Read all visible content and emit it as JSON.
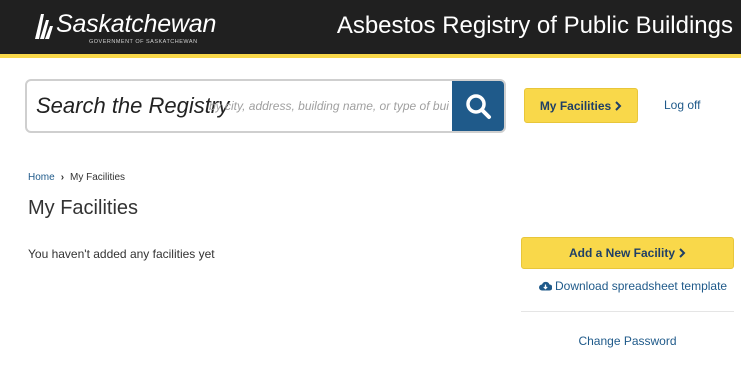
{
  "header": {
    "logo_text": "Saskatchewan",
    "logo_subtitle": "GOVERNMENT OF SASKATCHEWAN",
    "app_title": "Asbestos Registry of Public Buildings"
  },
  "search": {
    "label": "Search the Registry",
    "placeholder": "by city, address, building name, or type of building",
    "button_icon": "search-icon"
  },
  "nav": {
    "my_facilities_label": "My Facilities",
    "logoff_label": "Log off"
  },
  "breadcrumb": {
    "home": "Home",
    "current": "My Facilities"
  },
  "page": {
    "title": "My Facilities",
    "empty_message": "You haven't added any facilities yet"
  },
  "actions": {
    "add_facility_label": "Add a New Facility",
    "download_label": "Download spreadsheet template",
    "change_password_label": "Change Password"
  },
  "colors": {
    "header_bg": "#202020",
    "accent_yellow": "#f9d84a",
    "link_blue": "#1f5a8a"
  }
}
